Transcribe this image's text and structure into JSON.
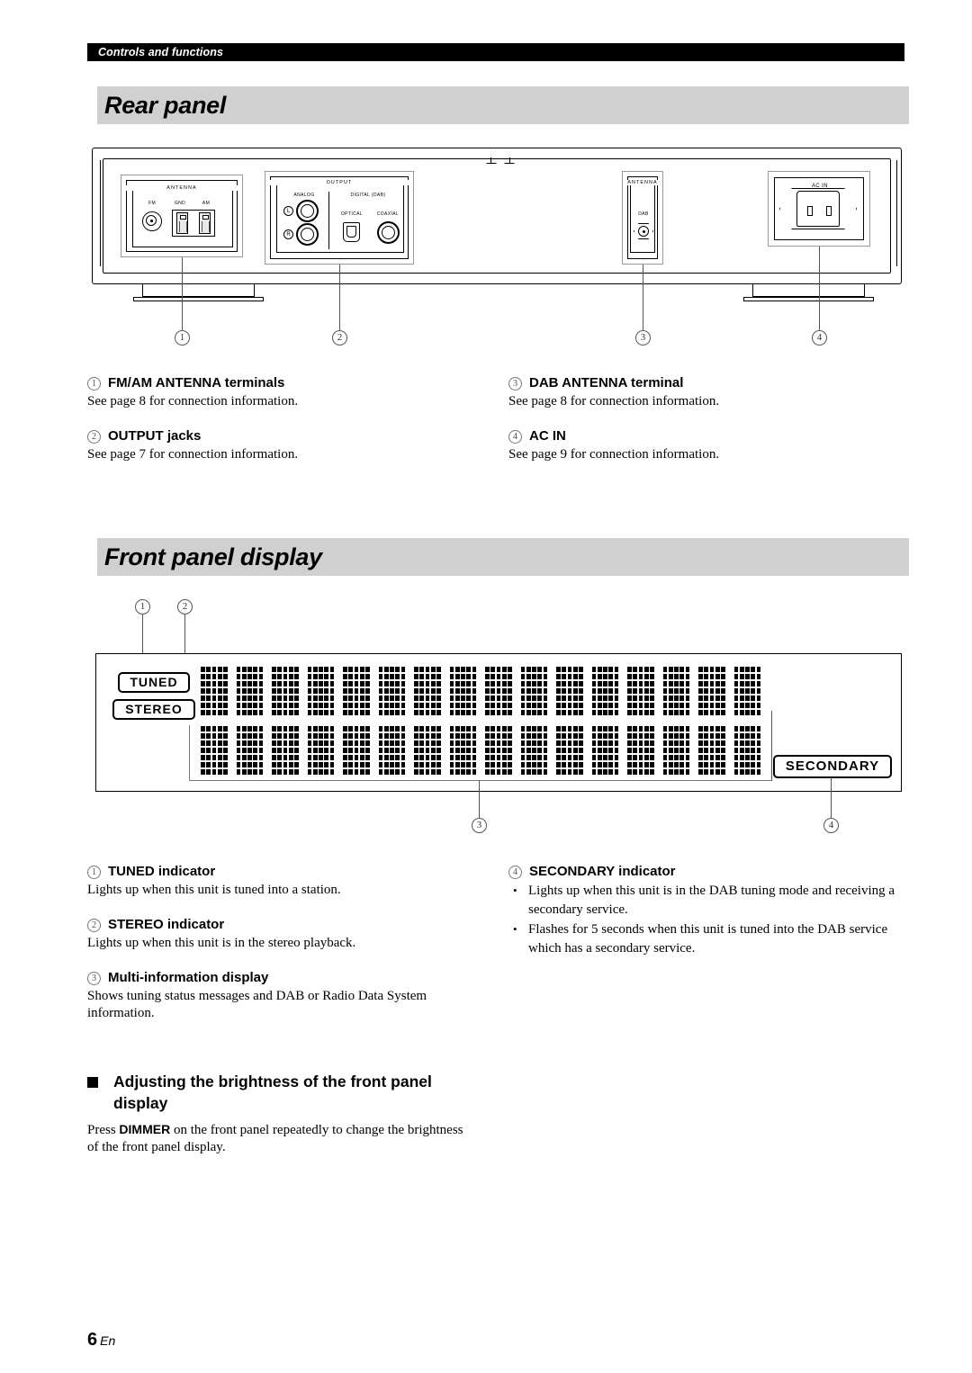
{
  "running_header": "Controls and functions",
  "sections": {
    "rear_panel": {
      "title": "Rear panel",
      "diagram": {
        "antenna_block": {
          "title": "ANTENNA",
          "fm_label": "FM",
          "gnd_label": "GND",
          "am_label": "AM"
        },
        "output_block": {
          "title": "OUTPUT",
          "analog_label": "ANALOG",
          "digital_label": "DIGITAL (DAB)",
          "left_label": "L",
          "right_label": "R",
          "optical_label": "OPTICAL",
          "coaxial_label": "COAXIAL"
        },
        "dab_block": {
          "title": "ANTENNA",
          "dab_label": "DAB"
        },
        "acin_block": {
          "title": "AC IN"
        },
        "callouts": [
          "1",
          "2",
          "3",
          "4"
        ]
      },
      "items": [
        {
          "num": "1",
          "heading": "FM/AM ANTENNA terminals",
          "body": "See page 8 for connection information."
        },
        {
          "num": "2",
          "heading": "OUTPUT jacks",
          "body": "See page 7 for connection information."
        },
        {
          "num": "3",
          "heading": "DAB ANTENNA terminal",
          "body": "See page 8 for connection information."
        },
        {
          "num": "4",
          "heading": "AC IN",
          "body": "See page 9 for connection information."
        }
      ]
    },
    "front_panel_display": {
      "title": "Front panel display",
      "diagram": {
        "tuned_label": "TUNED",
        "stereo_label": "STEREO",
        "secondary_label": "SECONDARY",
        "callouts": [
          "1",
          "2",
          "3",
          "4"
        ]
      },
      "items": [
        {
          "num": "1",
          "heading": "TUNED indicator",
          "body": "Lights up when this unit is tuned into a station."
        },
        {
          "num": "2",
          "heading": "STEREO indicator",
          "body": "Lights up when this unit is in the stereo playback."
        },
        {
          "num": "3",
          "heading": "Multi-information display",
          "body": "Shows tuning status messages and DAB or Radio Data System information."
        },
        {
          "num": "4",
          "heading": "SECONDARY indicator",
          "bullets": [
            "Lights up when this unit is in the DAB tuning mode and receiving a secondary service.",
            "Flashes for 5 seconds when this unit is tuned into the DAB service which has a secondary service."
          ]
        }
      ],
      "subsection": {
        "heading": "Adjusting the brightness of the front panel display",
        "body_before": "Press ",
        "body_bold": "DIMMER",
        "body_after": " on the front panel repeatedly to change the brightness of the front panel display."
      }
    }
  },
  "footer": {
    "page_number": "6",
    "language": "En"
  },
  "colors": {
    "header_bar": "#000000",
    "section_bar": "#d0d0d0",
    "text": "#000000",
    "leader_line": "#555555"
  }
}
